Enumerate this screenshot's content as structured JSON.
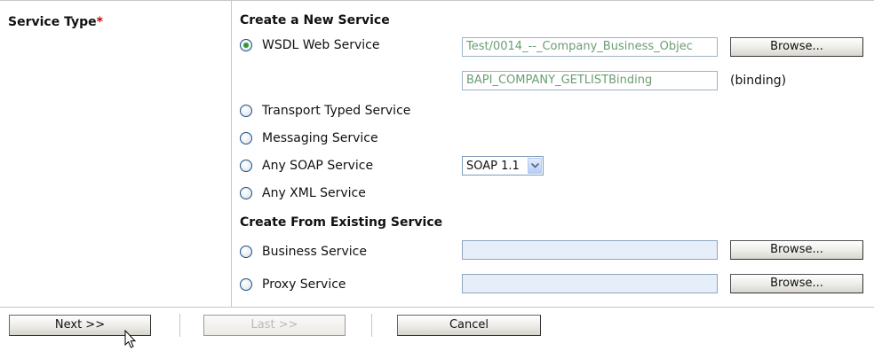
{
  "service_type": {
    "label": "Service Type",
    "required_marker": "*"
  },
  "create_new": {
    "heading": "Create a New Service",
    "wsdl": {
      "label": "WSDL Web Service",
      "checked": true,
      "resource_value": "Test/0014_--_Company_Business_Objec",
      "binding_value": "BAPI_COMPANY_GETLISTBinding",
      "binding_suffix": "(binding)",
      "browse_label": "Browse..."
    },
    "transport_typed": {
      "label": "Transport Typed Service"
    },
    "messaging": {
      "label": "Messaging Service"
    },
    "any_soap": {
      "label": "Any SOAP Service",
      "soap_version": "SOAP 1.1"
    },
    "any_xml": {
      "label": "Any XML Service"
    }
  },
  "create_existing": {
    "heading": "Create From Existing Service",
    "business": {
      "label": "Business Service",
      "value": "",
      "browse_label": "Browse..."
    },
    "proxy": {
      "label": "Proxy Service",
      "value": "",
      "browse_label": "Browse..."
    }
  },
  "wizard": {
    "next_label": "Next >>",
    "last_label": "Last >>",
    "cancel_label": "Cancel"
  },
  "icons": {
    "select_arrow": "chevron-down-icon",
    "cursor": "mouse-pointer-icon"
  },
  "colors": {
    "required": "#cc0000",
    "radio_selected": "#2f9a2a",
    "input_text": "#6a9e72",
    "empty_input_bg": "#e6eefa"
  }
}
